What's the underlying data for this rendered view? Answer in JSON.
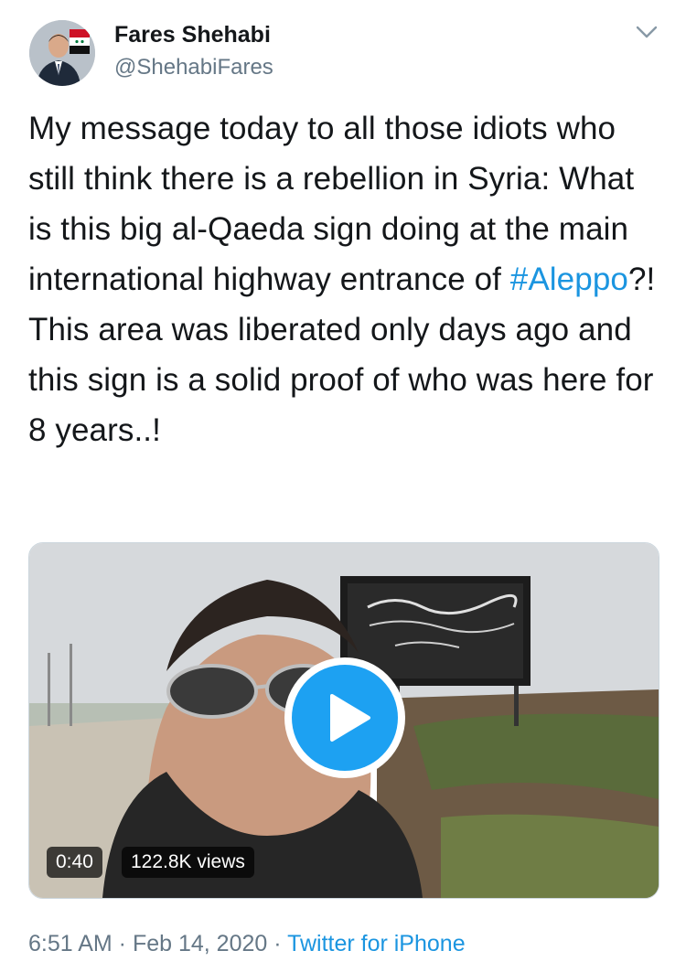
{
  "author": {
    "name": "Fares Shehabi",
    "handle": "@ShehabiFares"
  },
  "tweet": {
    "text_before": "My message today to all those idiots who still think there is a rebellion in Syria: What is this big al-Qaeda sign doing at the main international highway entrance of ",
    "hashtag": "#Aleppo",
    "text_after": "?! This area was liberated only days ago and this sign is a solid proof of who was here for 8 years..!"
  },
  "media": {
    "duration": "0:40",
    "views": "122.8K views",
    "play_icon": "play-icon"
  },
  "meta": {
    "time": "6:51 AM",
    "separator1": " · ",
    "date": "Feb 14, 2020",
    "separator2": " · ",
    "source": "Twitter for iPhone"
  },
  "colors": {
    "accent": "#1da1f2",
    "link": "#1b95e0",
    "secondary_text": "#657786",
    "primary_text": "#14171a"
  }
}
